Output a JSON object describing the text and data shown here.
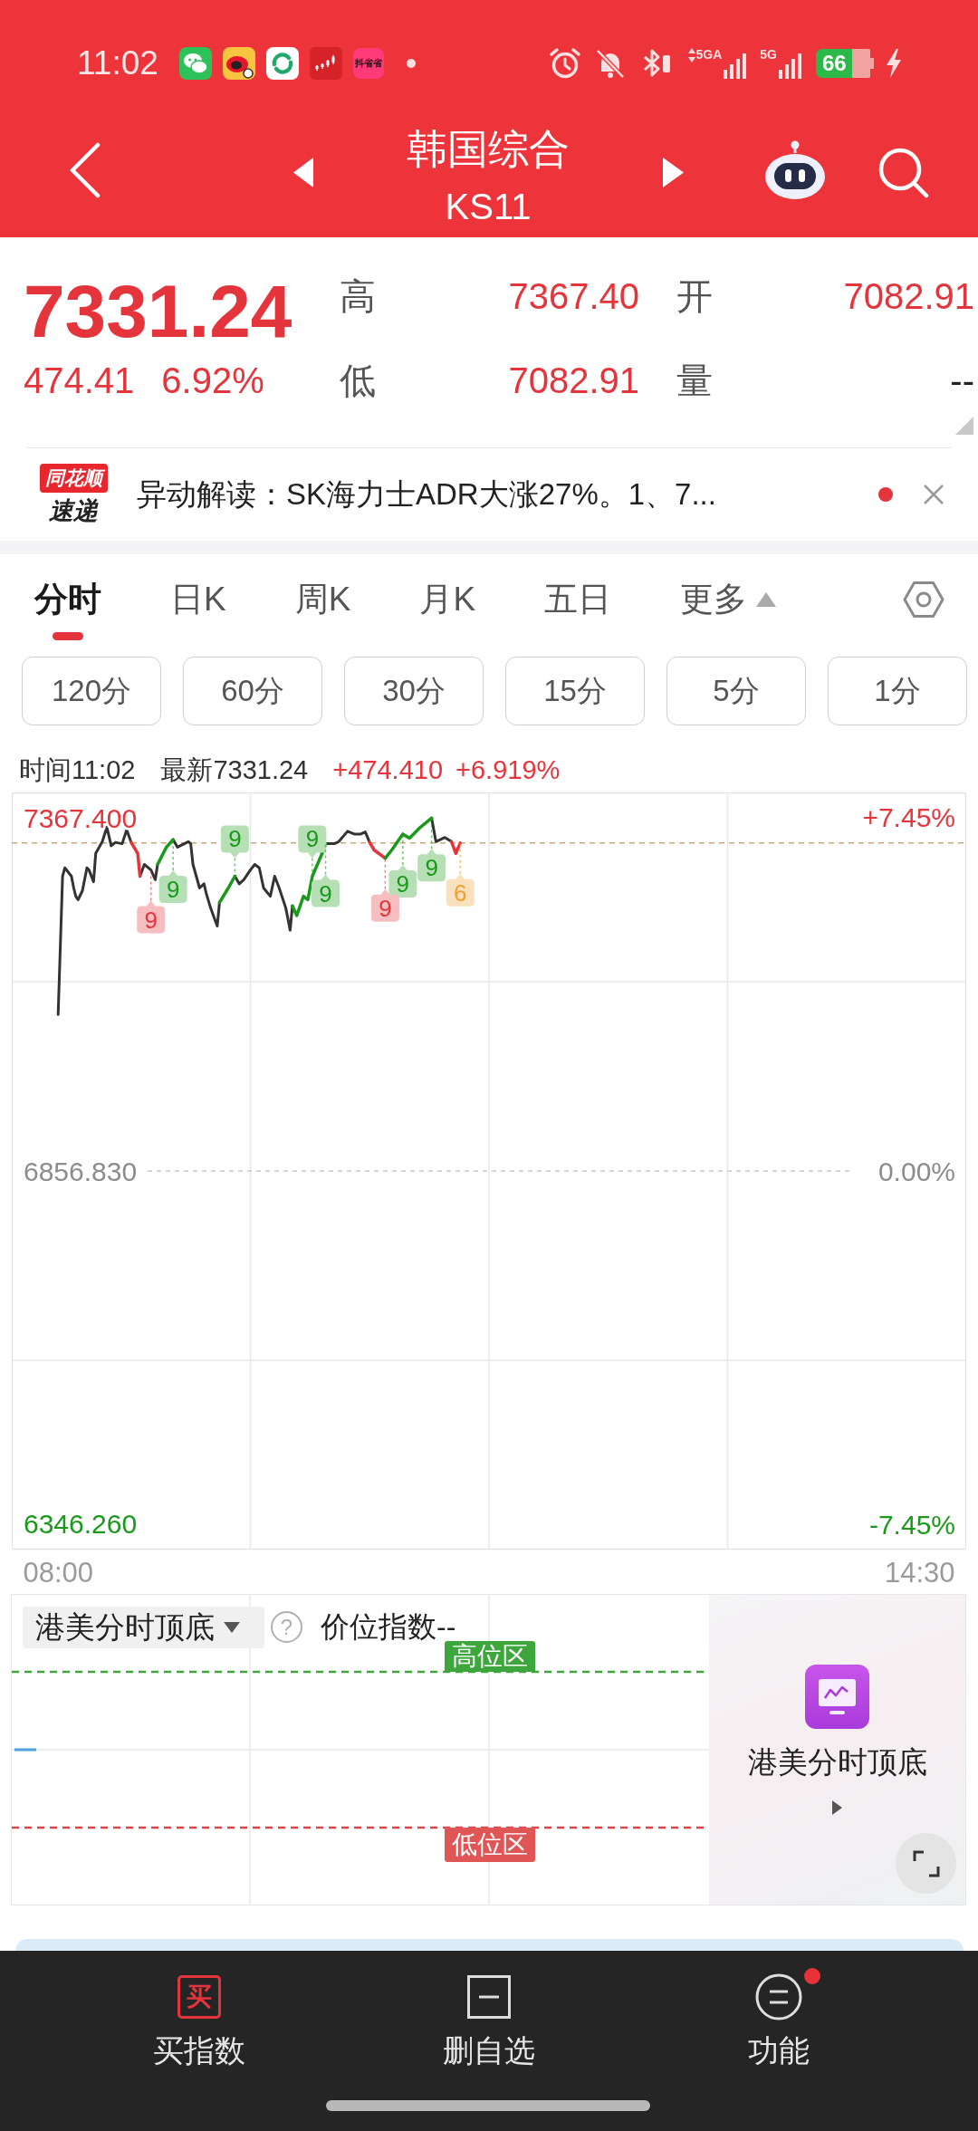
{
  "status_bar": {
    "time": "11:02",
    "app_icon_text": "抖省省",
    "network_labels": [
      "5GA",
      "5G"
    ],
    "battery": "66",
    "charging": true
  },
  "header": {
    "title": "韩国综合",
    "code": "KS11"
  },
  "quote": {
    "price": "7331.24",
    "change": "474.41",
    "change_pct": "6.92%",
    "rising": true,
    "stats": [
      {
        "label": "高",
        "value": "7367.40",
        "color": "#e3353b"
      },
      {
        "label": "开",
        "value": "7082.91",
        "color": "#e3353b"
      },
      {
        "label": "低",
        "value": "7082.91",
        "color": "#e3353b"
      },
      {
        "label": "量",
        "value": "--",
        "color": "#222222"
      }
    ]
  },
  "news": {
    "logo_tag": "同花顺",
    "logo_text": "速递",
    "text": "异动解读：SK海力士ADR大涨27%。1、7...",
    "unread": true
  },
  "tabs": [
    {
      "label": "分时",
      "selected": true,
      "kind": "tab"
    },
    {
      "label": "日K",
      "selected": false,
      "kind": "tab"
    },
    {
      "label": "周K",
      "selected": false,
      "kind": "tab"
    },
    {
      "label": "月K",
      "selected": false,
      "kind": "tab"
    },
    {
      "label": "五日",
      "selected": false,
      "kind": "tab"
    },
    {
      "label": "更多",
      "selected": false,
      "kind": "menu"
    }
  ],
  "intervals": [
    {
      "label": "120分",
      "selected": false
    },
    {
      "label": "60分",
      "selected": false
    },
    {
      "label": "30分",
      "selected": false
    },
    {
      "label": "15分",
      "selected": false
    },
    {
      "label": "5分",
      "selected": false
    },
    {
      "label": "1分",
      "selected": false
    }
  ],
  "chart_header": {
    "time": "时间11:02",
    "latest": "最新7331.24",
    "change": "+474.410",
    "change_pct": "+6.919%"
  },
  "chart": {
    "chart_data": {
      "type": "line",
      "x": [
        8,
        8.033,
        8.05,
        8.1,
        8.117,
        8.133,
        8.15,
        8.183,
        8.217,
        8.233,
        8.267,
        8.283,
        8.333,
        8.367,
        8.4,
        8.433,
        8.483,
        8.517,
        8.55,
        8.6,
        8.617,
        8.65,
        8.7,
        8.733,
        8.75,
        8.817,
        8.867,
        8.9,
        8.983,
        9,
        9.017,
        9.067,
        9.1,
        9.117,
        9.15,
        9.167,
        9.2,
        9.217,
        9.283,
        9.333,
        9.367,
        9.4,
        9.45,
        9.483,
        9.517,
        9.55,
        9.6,
        9.633,
        9.667,
        9.717,
        9.75,
        9.767,
        9.8,
        9.85,
        9.883,
        9.917,
        9.983,
        10.017,
        10.083,
        10.117,
        10.183,
        10.233,
        10.283,
        10.317,
        10.35,
        10.383,
        10.467,
        10.517,
        10.6,
        10.65,
        10.733,
        10.817,
        10.85,
        10.917,
        10.967,
        11,
        11.033
      ],
      "series": [
        {
          "color": "#333333",
          "values": [
            7083,
            7283,
            7295,
            7283,
            7266,
            7254,
            7249,
            7262,
            7295,
            7292,
            7275,
            7316,
            7333,
            7354,
            7327,
            7332,
            7330,
            7350,
            7332,
            null,
            7283,
            7300,
            7292,
            7278,
            7300,
            null,
            7336,
            7325,
            7333,
            7330,
            7300,
            7266,
            7272,
            7258,
            7237,
            7228,
            7211,
            7245,
            null,
            7283,
            7272,
            7278,
            7292,
            7300,
            7295,
            7266,
            7254,
            7283,
            7266,
            7237,
            7205,
            7240,
            null,
            null,
            null,
            null,
            null,
            7330,
            7330,
            7333,
            7348,
            7344,
            7344,
            7347,
            7332,
            null,
            null,
            null,
            null,
            null,
            null,
            7367,
            7333,
            7339,
            7333,
            null,
            null
          ]
        },
        {
          "color": "#e3353b",
          "values": [
            null,
            null,
            null,
            null,
            null,
            null,
            null,
            null,
            null,
            null,
            null,
            null,
            null,
            null,
            null,
            null,
            null,
            null,
            7332,
            7316,
            7283,
            null,
            null,
            null,
            null,
            null,
            null,
            null,
            null,
            null,
            null,
            null,
            null,
            null,
            null,
            null,
            null,
            null,
            null,
            null,
            null,
            null,
            null,
            null,
            null,
            null,
            null,
            null,
            null,
            null,
            null,
            null,
            null,
            null,
            null,
            null,
            null,
            null,
            null,
            null,
            null,
            null,
            null,
            null,
            7332,
            7321,
            7309,
            null,
            null,
            null,
            null,
            null,
            null,
            null,
            7333,
            7316,
            7331
          ]
        },
        {
          "color": "#1a9a1a",
          "values": [
            null,
            null,
            null,
            null,
            null,
            null,
            null,
            null,
            null,
            null,
            null,
            null,
            null,
            null,
            null,
            null,
            null,
            null,
            null,
            null,
            null,
            null,
            null,
            null,
            7300,
            7325,
            7336,
            null,
            null,
            null,
            null,
            null,
            null,
            null,
            null,
            null,
            null,
            7245,
            7266,
            7283,
            null,
            null,
            null,
            null,
            null,
            null,
            null,
            null,
            null,
            null,
            null,
            7240,
            7226,
            7254,
            7249,
            7283,
            7312,
            7330,
            null,
            null,
            null,
            null,
            null,
            null,
            null,
            null,
            7309,
            7321,
            7344,
            7338,
            7354,
            7367,
            null,
            null,
            null,
            null,
            null
          ]
        }
      ],
      "xlim": [
        7.65,
        14.85
      ],
      "ylim": [
        6309.6,
        7404.1
      ],
      "xticks": [
        {
          "value": 8,
          "label": "08:00"
        },
        {
          "value": 14.5,
          "label": "14:30"
        }
      ],
      "yticks": [
        {
          "value": 7367.4,
          "label": "7367.400"
        },
        {
          "value": 6856.83,
          "label": "6856.830"
        },
        {
          "value": 6346.26,
          "label": "6346.260"
        }
      ],
      "y2lim": [
        -7.98,
        7.98
      ],
      "y2ticks": [
        {
          "value": 7.45,
          "label": "+7.45%"
        },
        {
          "value": 0,
          "label": "0.00%"
        },
        {
          "value": -7.45,
          "label": "-7.45%"
        }
      ],
      "ref_lines": [
        {
          "axis": "y",
          "value": 6856.83
        },
        {
          "axis": "y",
          "value": 7331
        }
      ],
      "annotations": [
        {
          "x": 8.867,
          "y": 7336,
          "text": "9"
        },
        {
          "x": 8.7,
          "y": 7292,
          "text": "9"
        },
        {
          "x": 9.333,
          "y": 7283,
          "text": "9"
        },
        {
          "x": 9.917,
          "y": 7283,
          "text": "9"
        },
        {
          "x": 10.017,
          "y": 7330,
          "text": "9"
        },
        {
          "x": 10.817,
          "y": 7367,
          "text": "9"
        },
        {
          "x": 10.6,
          "y": 7344,
          "text": "9"
        },
        {
          "x": 10.467,
          "y": 7309,
          "text": "9"
        },
        {
          "x": 11.033,
          "y": 7331,
          "text": "6"
        }
      ]
    },
    "signal_badges": [
      {
        "color": "#1a9a1a",
        "above": false
      },
      {
        "color": "#e3353b",
        "above": false
      },
      {
        "color": "#1a9a1a",
        "above": true
      },
      {
        "color": "#1a9a1a",
        "above": true
      },
      {
        "color": "#1a9a1a",
        "above": false
      },
      {
        "color": "#1a9a1a",
        "above": false
      },
      {
        "color": "#1a9a1a",
        "above": false
      },
      {
        "color": "#e3353b",
        "above": false
      },
      {
        "color": "#f0a030",
        "above": false
      }
    ]
  },
  "indicator": {
    "selector": "港美分时顶底",
    "help": "?",
    "value_label": "价位指数--",
    "high_zone": "高位区",
    "low_zone": "低位区"
  },
  "promo": {
    "title": "港美分时顶底"
  },
  "bottom_nav": [
    {
      "kind": "buy",
      "icon_text": "买",
      "label": "买指数",
      "alert": false
    },
    {
      "kind": "remove",
      "label": "删自选",
      "alert": false
    },
    {
      "kind": "menu",
      "label": "功能",
      "alert": true
    }
  ]
}
